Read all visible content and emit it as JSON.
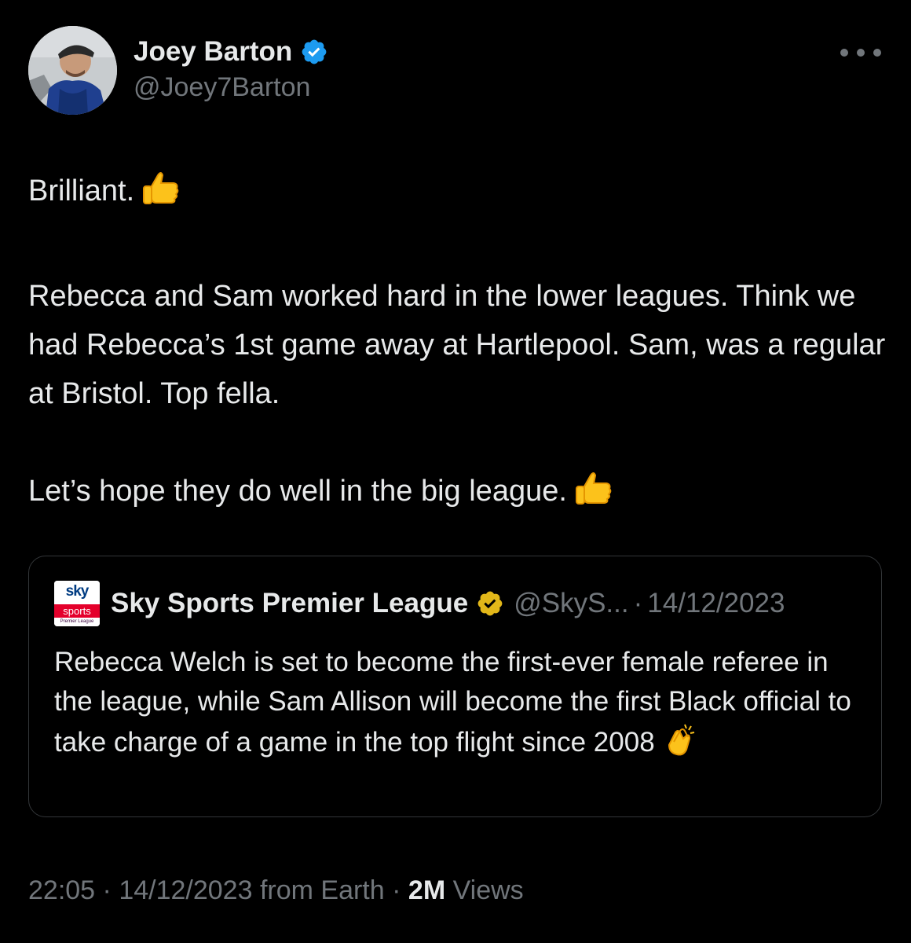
{
  "author": {
    "display_name": "Joey Barton",
    "handle": "@Joey7Barton"
  },
  "tweet": {
    "paragraphs": [
      "Brilliant.",
      "Rebecca and Sam worked hard in the lower leagues. Think we had Rebecca’s 1st game away at Hartlepool. Sam, was a regular at Bristol. Top fella.",
      "Let’s hope they do well in the big league."
    ]
  },
  "quote": {
    "logo_text": {
      "top": "sky",
      "middle": "sports",
      "bottom": "Premier League"
    },
    "display_name": "Sky Sports Premier League",
    "handle": "@SkyS...",
    "separator": "·",
    "date": "14/12/2023",
    "text": "Rebecca Welch is set to become the first-ever female referee in the league, while Sam Allison will become the first Black official to take charge of a game in the top flight since 2008"
  },
  "footer": {
    "time": "22:05",
    "sep1": "·",
    "date": "14/12/2023",
    "source": "from Earth",
    "sep2": "·",
    "views_count": "2M",
    "views_label": "Views"
  },
  "colors": {
    "background": "#000000",
    "text": "#e7e9ea",
    "muted": "#71767b",
    "verified_blue": "#1d9bf0",
    "verified_gold": "#e2b719",
    "border": "#333639"
  },
  "icons": [
    "verified-badge-icon",
    "more-options-icon",
    "thumbs-up-icon",
    "clapping-hands-icon",
    "gold-verified-badge-icon"
  ]
}
